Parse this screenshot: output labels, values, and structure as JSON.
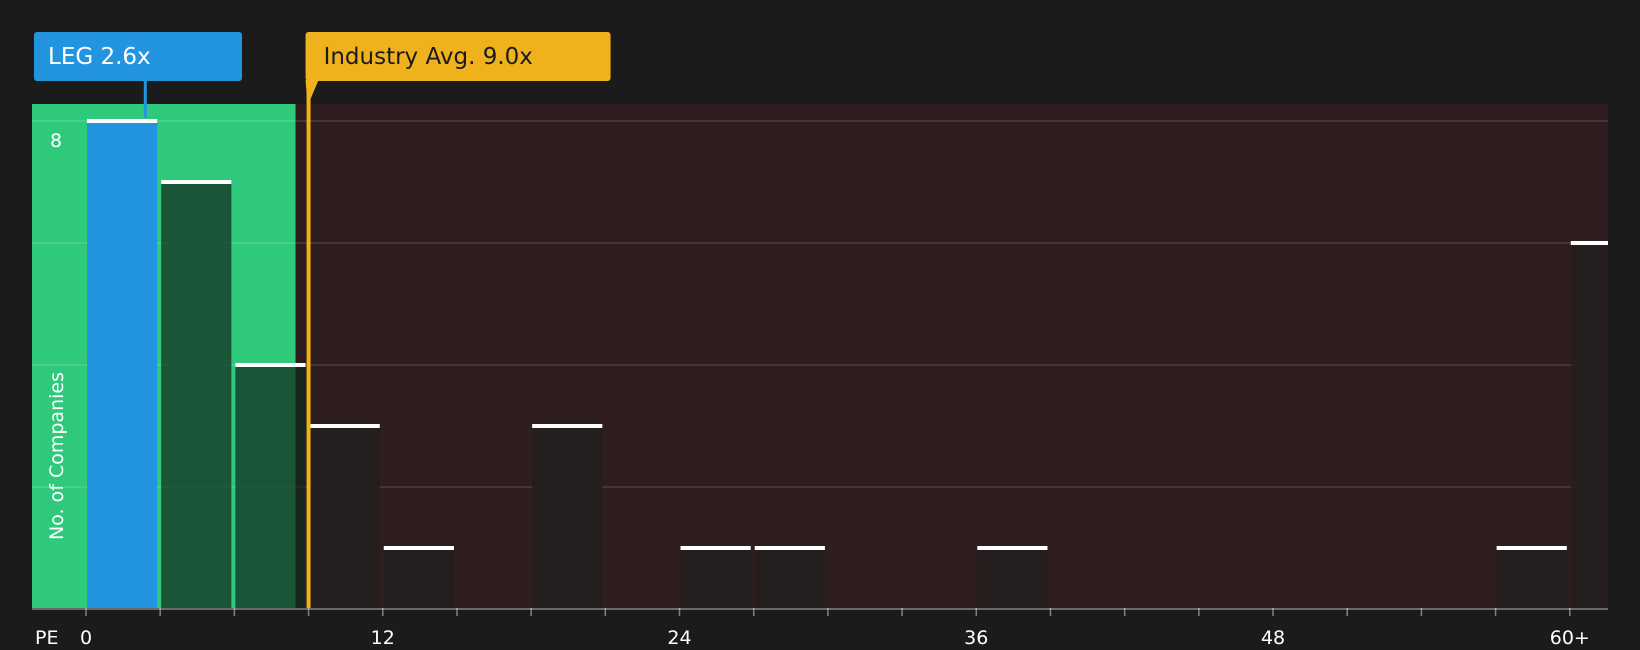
{
  "chart_data": {
    "type": "bar",
    "title": "",
    "xlabel": "PE",
    "ylabel": "No. of Companies",
    "x_ticks": [
      "0",
      "12",
      "24",
      "36",
      "48",
      "60+"
    ],
    "x_tick_values": [
      0,
      12,
      24,
      36,
      48,
      60
    ],
    "xlim": [
      0,
      61.5
    ],
    "ylim": [
      0,
      8
    ],
    "y_ticks": [
      8
    ],
    "y_tick_labels": [
      "8"
    ],
    "bin_width": 3,
    "bins": [
      {
        "x0": 0,
        "count": 8
      },
      {
        "x0": 3,
        "count": 7
      },
      {
        "x0": 6,
        "count": 4
      },
      {
        "x0": 9,
        "count": 3
      },
      {
        "x0": 12,
        "count": 1
      },
      {
        "x0": 15,
        "count": 0
      },
      {
        "x0": 18,
        "count": 3
      },
      {
        "x0": 21,
        "count": 0
      },
      {
        "x0": 24,
        "count": 1
      },
      {
        "x0": 27,
        "count": 1
      },
      {
        "x0": 30,
        "count": 0
      },
      {
        "x0": 33,
        "count": 0
      },
      {
        "x0": 36,
        "count": 1
      },
      {
        "x0": 39,
        "count": 0
      },
      {
        "x0": 42,
        "count": 0
      },
      {
        "x0": 45,
        "count": 0
      },
      {
        "x0": 48,
        "count": 0
      },
      {
        "x0": 51,
        "count": 0
      },
      {
        "x0": 54,
        "count": 0
      },
      {
        "x0": 57,
        "count": 1
      },
      {
        "x0": 60,
        "count": 6
      }
    ],
    "company": {
      "label": "LEG 2.6x",
      "value": 2.6
    },
    "industry_avg": {
      "label": "Industry Avg. 9.0x",
      "value": 9.0
    },
    "grid": true
  },
  "colors": {
    "background": "#1b1b1b",
    "undervalued_zone": "#2ec97a",
    "overvalued_zone": "#2e1e1f",
    "company_bar": "#2394e0",
    "company_label_bg": "#2394e0",
    "industry_line": "#f0b21c",
    "industry_label_bg": "#f0b21c",
    "bar_cap": "#ffffff"
  }
}
